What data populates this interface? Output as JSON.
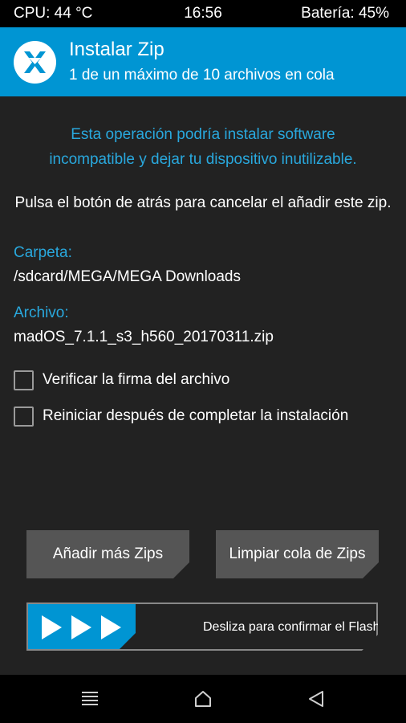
{
  "status": {
    "cpu": "CPU: 44 °C",
    "time": "16:56",
    "battery": "Batería: 45%"
  },
  "header": {
    "title": "Instalar Zip",
    "subtitle": "1 de un máximo de 10 archivos en cola"
  },
  "main": {
    "warning_line1": "Esta operación podría instalar software",
    "warning_line2": "incompatible y dejar tu dispositivo inutilizable.",
    "cancel_message": "Pulsa el botón de atrás para cancelar el añadir este zip.",
    "folder_label": "Carpeta:",
    "folder_value": "/sdcard/MEGA/MEGA Downloads",
    "file_label": "Archivo:",
    "file_value": "madOS_7.1.1_s3_h560_20170311.zip",
    "options": [
      {
        "label": "Verificar la firma del archivo",
        "checked": false
      },
      {
        "label": "Reiniciar después de completar la instalación",
        "checked": false
      }
    ]
  },
  "buttons": {
    "add_more": "Añadir más Zips",
    "clear_queue": "Limpiar cola de Zips"
  },
  "slider": {
    "label": "Desliza para confirmar el Flasheo"
  },
  "colors": {
    "accent": "#0095d3",
    "accent_text": "#29a8dd",
    "background": "#222222",
    "button": "#555555"
  },
  "icons": {
    "logo": "twrp-logo-icon",
    "nav_menu": "menu-icon",
    "nav_home": "home-icon",
    "nav_back": "back-icon"
  }
}
